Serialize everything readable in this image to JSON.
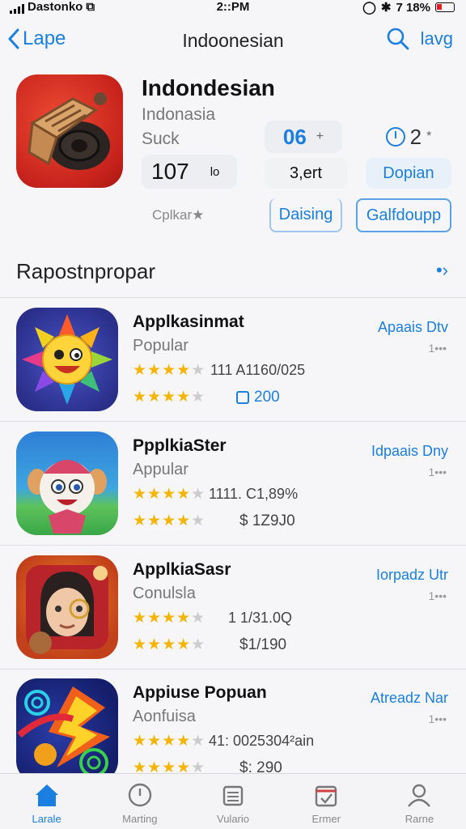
{
  "status": {
    "carrier": "Dastonko",
    "time": "2::PM",
    "battery": "7 18%"
  },
  "nav": {
    "back_label": "Lape",
    "title": "Indoonesian",
    "right_label": "lavg"
  },
  "hero": {
    "name": "Indondesian",
    "subtitle": "Indonasia",
    "subtitle2": "Suck",
    "score": "107",
    "score_suffix": "lo",
    "stat1_value": "06",
    "stat1_suffix": "+",
    "stat2_value": "2",
    "stat2_suffix": "*",
    "stat3": "3,ert",
    "stat4": "Dopian",
    "category": "Cplkar★",
    "button1": "Daising",
    "button2": "Galfdoupp"
  },
  "section": {
    "title": "Rapostnpropar",
    "more": "•›"
  },
  "apps": [
    {
      "name": "Applkasinmat",
      "sub": "Popular",
      "tag": "Apaais Dtv",
      "dots": "1•••",
      "stars1": "★★★★★",
      "val1": "111 A1160/025",
      "stars2": "★★★★★",
      "val2": "200"
    },
    {
      "name": "PpplkiaSter",
      "sub": "Appular",
      "tag": "Idpaais Dny",
      "dots": "1•••",
      "stars1": "★★★★★",
      "val1": "1111. C1,89%",
      "stars2": "★★★★★",
      "val2": "$ 1Z9J0"
    },
    {
      "name": "ApplkiaSasr",
      "sub": "Conulsla",
      "tag": "Iorpadz Utr",
      "dots": "1•••",
      "stars1": "★★★★★",
      "val1": "1  1/31.0Q",
      "stars2": "★★★★★",
      "val2": "$1/190"
    },
    {
      "name": "Appiuse Popuan",
      "sub": "Aonfuisa",
      "tag": "Atreadz Nar",
      "dots": "1•••",
      "stars1": "★★★★★",
      "val1": "41:  0025304²ain",
      "stars2": "★★★★★",
      "val2": "$: 290"
    }
  ],
  "tabs": [
    "Larale",
    "Marting",
    "Vulario",
    "Ermer",
    "Rarne"
  ]
}
